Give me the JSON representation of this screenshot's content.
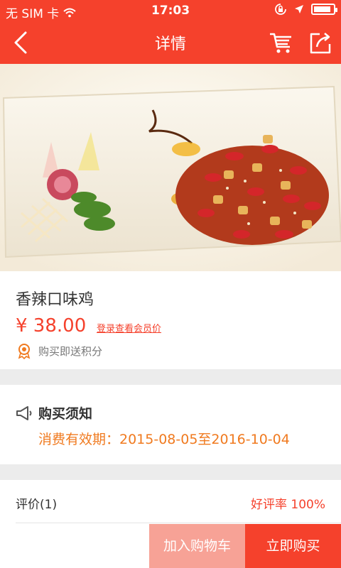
{
  "status_bar": {
    "carrier": "无 SIM 卡",
    "time": "17:03",
    "battery_level": 0.9
  },
  "nav": {
    "title": "详情"
  },
  "product": {
    "name": "香辣口味鸡",
    "price": "¥ 38.00",
    "member_price_link": "登录查看会员价",
    "points_text": "购买即送积分"
  },
  "notice": {
    "title": "购买须知",
    "validity": "消费有效期：2015-08-05至2016-10-04"
  },
  "review": {
    "label": "评价(1)",
    "rate": "好评率  100%"
  },
  "actions": {
    "add_to_cart": "加入购物车",
    "buy_now": "立即购买"
  },
  "colors": {
    "accent": "#f5412c",
    "accent_light": "#f7a296",
    "notice_orange": "#f07a1f"
  },
  "icons": [
    "wifi-icon",
    "lock-rotation-icon",
    "location-arrow-icon",
    "battery-icon",
    "back-arrow-icon",
    "cart-icon",
    "share-icon",
    "award-icon",
    "megaphone-icon"
  ]
}
